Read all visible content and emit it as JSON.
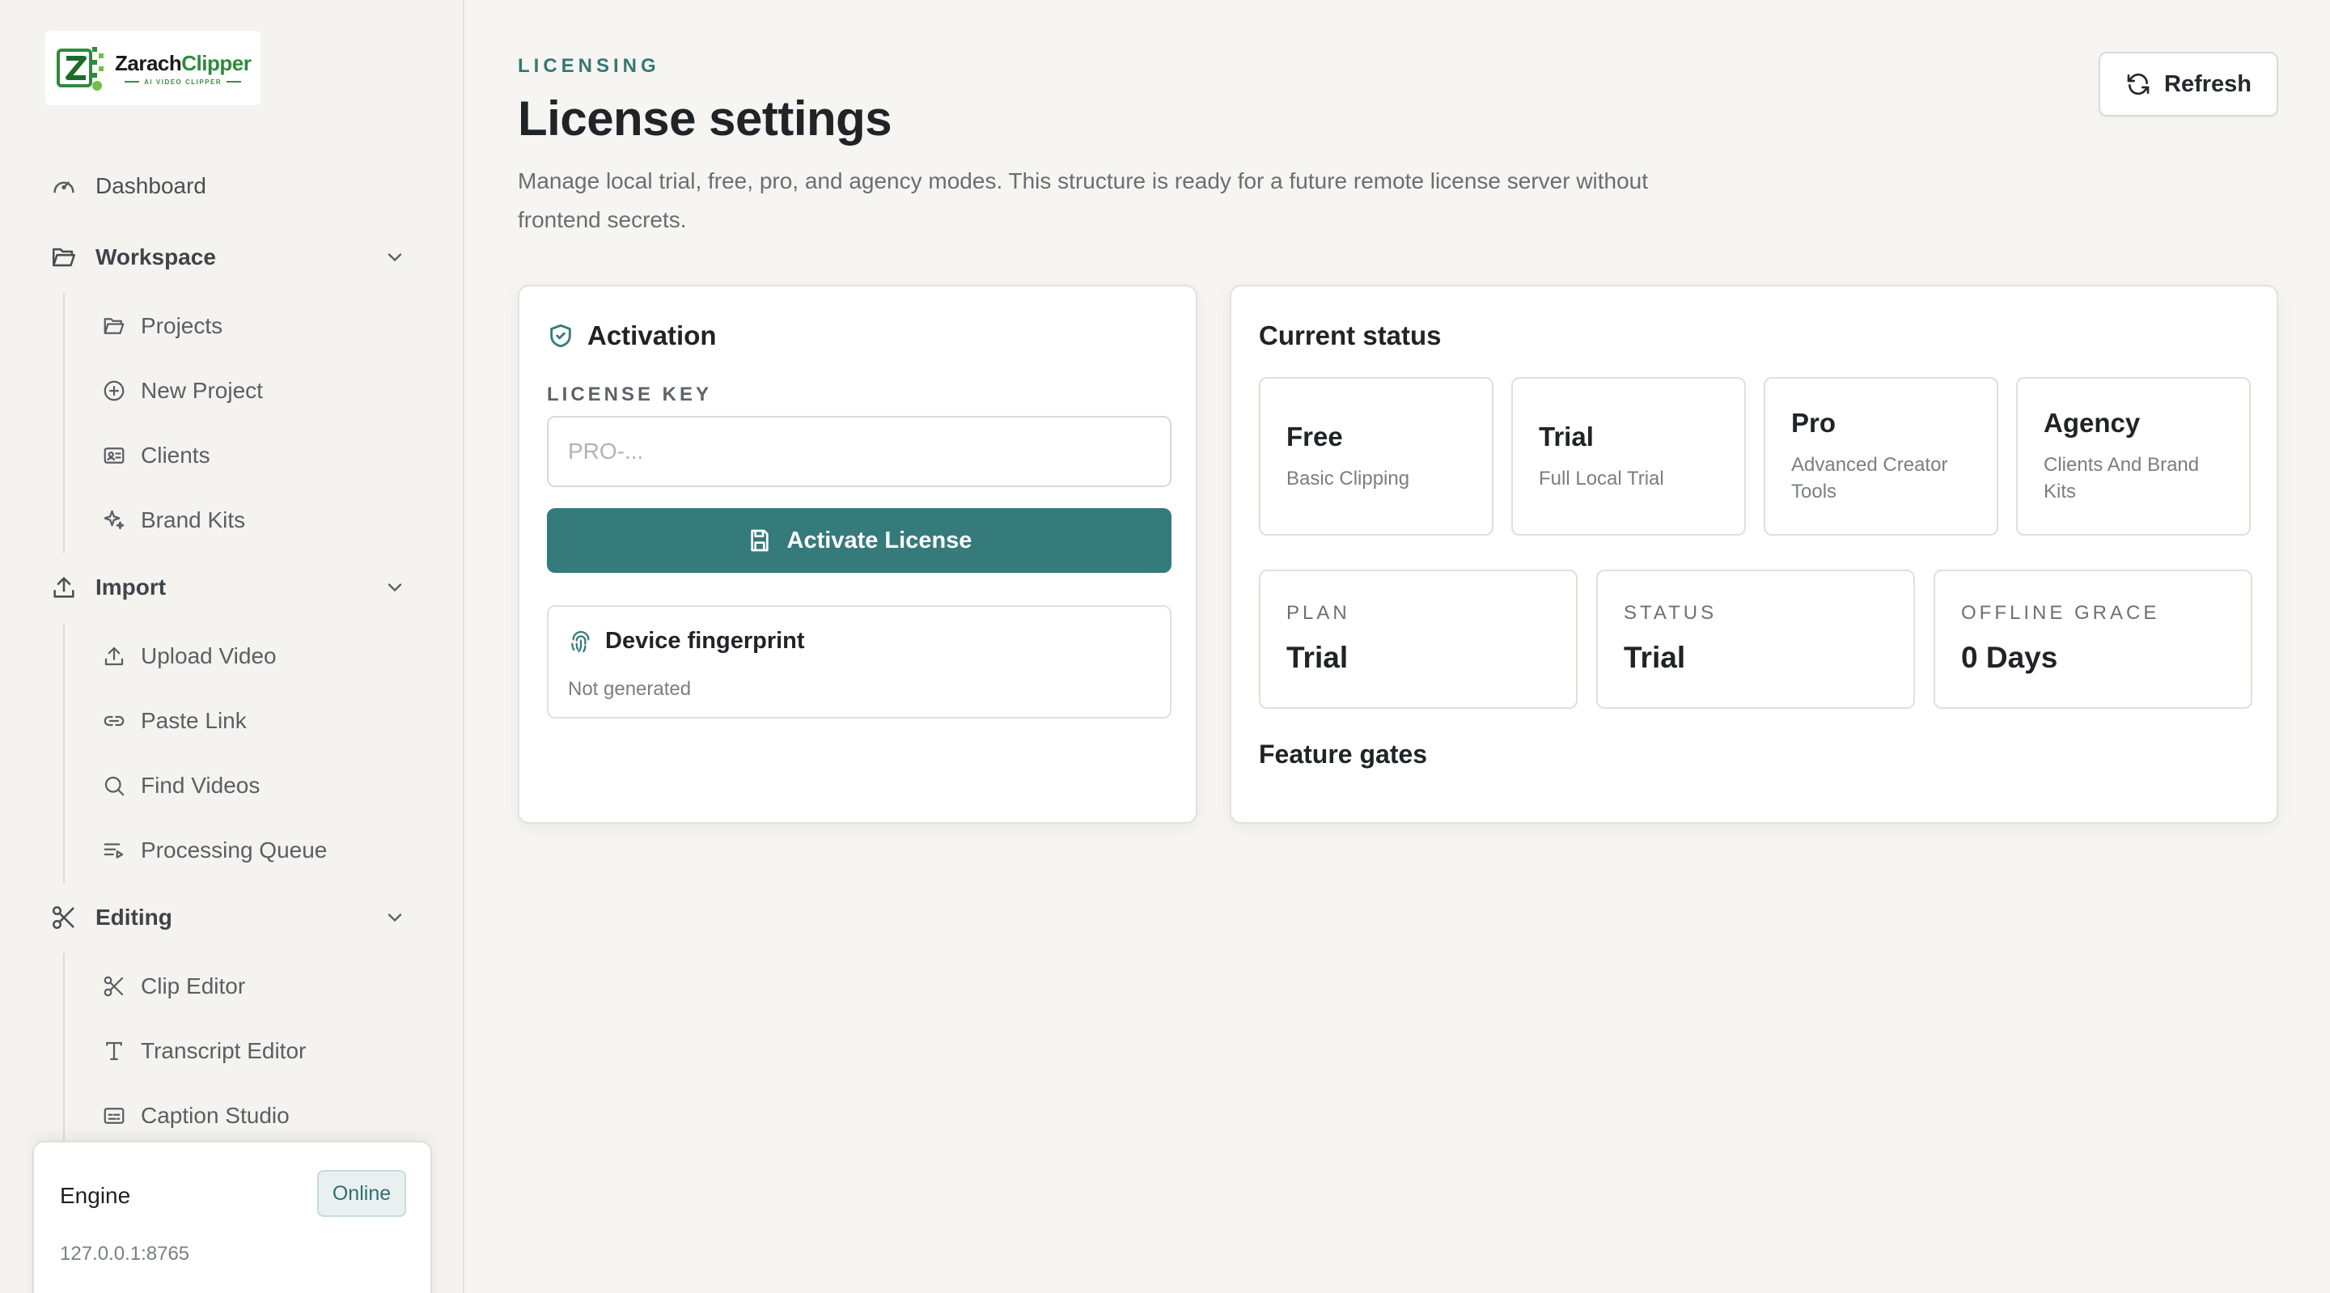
{
  "app": {
    "name_part1": "Zarach",
    "name_part2": "Clipper",
    "tagline": "AI VIDEO CLIPPER"
  },
  "sidebar": {
    "dashboard": "Dashboard",
    "sections": [
      {
        "label": "Workspace",
        "items": [
          "Projects",
          "New Project",
          "Clients",
          "Brand Kits"
        ]
      },
      {
        "label": "Import",
        "items": [
          "Upload Video",
          "Paste Link",
          "Find Videos",
          "Processing Queue"
        ]
      },
      {
        "label": "Editing",
        "items": [
          "Clip Editor",
          "Transcript Editor",
          "Caption Studio"
        ]
      }
    ]
  },
  "engine": {
    "title": "Engine",
    "status": "Online",
    "address": "127.0.0.1:8765"
  },
  "header": {
    "eyebrow": "LICENSING",
    "title": "License settings",
    "description": "Manage local trial, free, pro, and agency modes. This structure is ready for a future remote license server without frontend secrets.",
    "refresh_label": "Refresh"
  },
  "activation": {
    "title": "Activation",
    "field_label": "LICENSE KEY",
    "placeholder": "PRO-...",
    "value": "",
    "button_label": "Activate License",
    "fingerprint_title": "Device fingerprint",
    "fingerprint_value": "Not generated"
  },
  "status": {
    "title": "Current status",
    "plans": [
      {
        "name": "Free",
        "desc": "Basic Clipping"
      },
      {
        "name": "Trial",
        "desc": "Full Local Trial"
      },
      {
        "name": "Pro",
        "desc": "Advanced Creator Tools"
      },
      {
        "name": "Agency",
        "desc": "Clients And Brand Kits"
      }
    ],
    "stats": [
      {
        "label": "PLAN",
        "value": "Trial"
      },
      {
        "label": "STATUS",
        "value": "Trial"
      },
      {
        "label": "OFFLINE GRACE",
        "value": "0 Days"
      }
    ],
    "feature_gates_title": "Feature gates"
  },
  "colors": {
    "accent": "#357b7c",
    "eyebrow": "#357774",
    "brand_green": "#2f8a3c",
    "background": "#f6f5f2"
  }
}
